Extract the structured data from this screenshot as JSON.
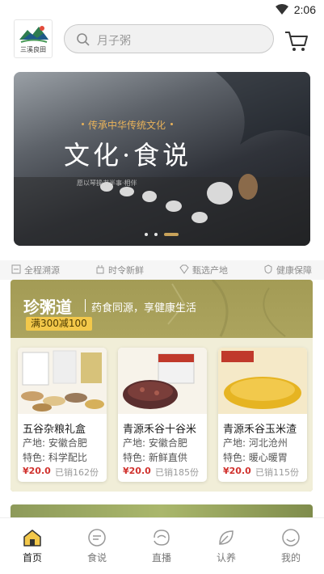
{
  "status_bar": {
    "time": "2:06"
  },
  "header": {
    "logo_text": "三溪良田",
    "search_placeholder": "月子粥"
  },
  "banner": {
    "subtitle": "传承中华传统文化",
    "title": "文化·食说",
    "small_text": "愿以琴操书半事·相伴",
    "slides": 3,
    "active_slide": 3
  },
  "features": [
    {
      "icon": "trace-icon",
      "label": "全程溯源"
    },
    {
      "icon": "seasonal-icon",
      "label": "时令新鲜"
    },
    {
      "icon": "diamond-icon",
      "label": "甄选产地"
    },
    {
      "icon": "shield-icon",
      "label": "健康保障"
    }
  ],
  "promo": {
    "title": "珍粥道",
    "slogan": "药食同源，享健康生活",
    "badge": "满300减100",
    "products": [
      {
        "name": "五谷杂粮礼盒",
        "origin": "产地: 安徽合肥",
        "feature": "特色: 科学配比",
        "price": "¥20.0",
        "sold": "已销162份"
      },
      {
        "name": "青源禾谷十谷米",
        "origin": "产地: 安徽合肥",
        "feature": "特色: 新鲜直供",
        "price": "¥20.0",
        "sold": "已销185份"
      },
      {
        "name": "青源禾谷玉米渣",
        "origin": "产地: 河北沧州",
        "feature": "特色: 暖心暖胃",
        "price": "¥20.0",
        "sold": "已销115份"
      }
    ]
  },
  "nav": {
    "items": [
      {
        "label": "首页",
        "icon": "home-icon",
        "active": true
      },
      {
        "label": "食说",
        "icon": "chat-icon",
        "active": false
      },
      {
        "label": "直播",
        "icon": "live-icon",
        "active": false
      },
      {
        "label": "认养",
        "icon": "leaf-icon",
        "active": false
      },
      {
        "label": "我的",
        "icon": "profile-icon",
        "active": false
      }
    ]
  },
  "colors": {
    "accent": "#f3c84a",
    "price": "#d0312d",
    "promo_bg": "#a39b55"
  }
}
